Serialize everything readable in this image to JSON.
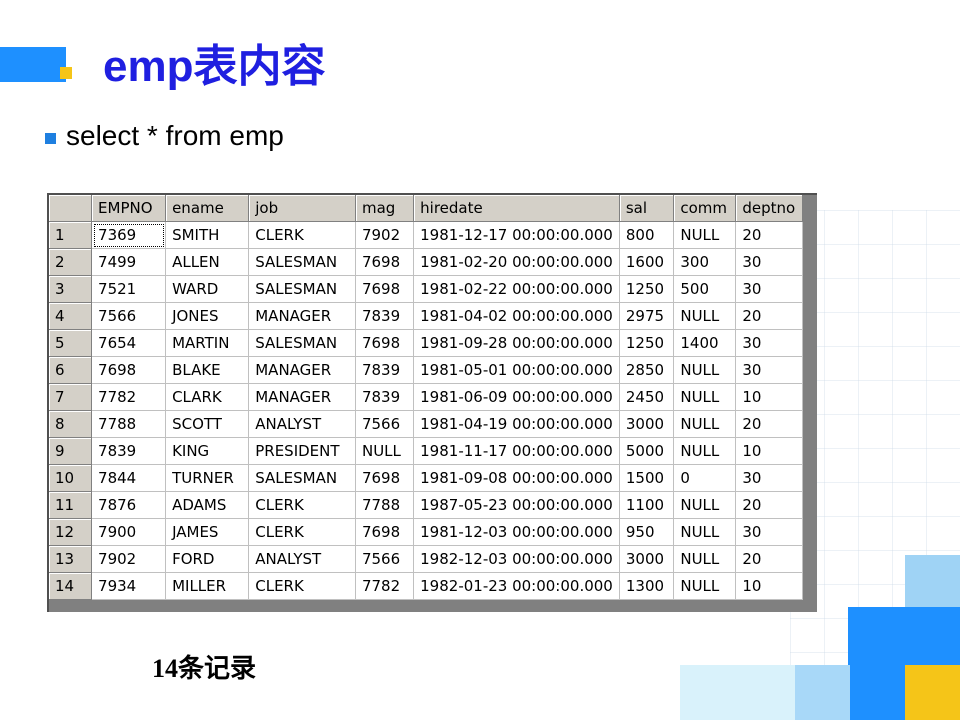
{
  "slide": {
    "title": "emp表内容",
    "bullet": "select * from emp",
    "caption": "14条记录"
  },
  "colors": {
    "title": "#1f1fe0",
    "accent_blue": "#1e90ff",
    "accent_yellow": "#f5c518",
    "grid_header": "#d4d0c8"
  },
  "table": {
    "columns": [
      "",
      "EMPNO",
      "ename",
      "job",
      "mag",
      "hiredate",
      "sal",
      "comm",
      "deptno"
    ],
    "rows": [
      [
        "1",
        "7369",
        "SMITH",
        "CLERK",
        "7902",
        "1981-12-17 00:00:00.000",
        "800",
        "NULL",
        "20"
      ],
      [
        "2",
        "7499",
        "ALLEN",
        "SALESMAN",
        "7698",
        "1981-02-20 00:00:00.000",
        "1600",
        "300",
        "30"
      ],
      [
        "3",
        "7521",
        "WARD",
        "SALESMAN",
        "7698",
        "1981-02-22 00:00:00.000",
        "1250",
        "500",
        "30"
      ],
      [
        "4",
        "7566",
        "JONES",
        "MANAGER",
        "7839",
        "1981-04-02 00:00:00.000",
        "2975",
        "NULL",
        "20"
      ],
      [
        "5",
        "7654",
        "MARTIN",
        "SALESMAN",
        "7698",
        "1981-09-28 00:00:00.000",
        "1250",
        "1400",
        "30"
      ],
      [
        "6",
        "7698",
        "BLAKE",
        "MANAGER",
        "7839",
        "1981-05-01 00:00:00.000",
        "2850",
        "NULL",
        "30"
      ],
      [
        "7",
        "7782",
        "CLARK",
        "MANAGER",
        "7839",
        "1981-06-09 00:00:00.000",
        "2450",
        "NULL",
        "10"
      ],
      [
        "8",
        "7788",
        "SCOTT",
        "ANALYST",
        "7566",
        "1981-04-19 00:00:00.000",
        "3000",
        "NULL",
        "20"
      ],
      [
        "9",
        "7839",
        "KING",
        "PRESIDENT",
        "NULL",
        "1981-11-17 00:00:00.000",
        "5000",
        "NULL",
        "10"
      ],
      [
        "10",
        "7844",
        "TURNER",
        "SALESMAN",
        "7698",
        "1981-09-08 00:00:00.000",
        "1500",
        "0",
        "30"
      ],
      [
        "11",
        "7876",
        "ADAMS",
        "CLERK",
        "7788",
        "1987-05-23 00:00:00.000",
        "1100",
        "NULL",
        "20"
      ],
      [
        "12",
        "7900",
        "JAMES",
        "CLERK",
        "7698",
        "1981-12-03 00:00:00.000",
        "950",
        "NULL",
        "30"
      ],
      [
        "13",
        "7902",
        "FORD",
        "ANALYST",
        "7566",
        "1982-12-03 00:00:00.000",
        "3000",
        "NULL",
        "20"
      ],
      [
        "14",
        "7934",
        "MILLER",
        "CLERK",
        "7782",
        "1982-01-23 00:00:00.000",
        "1300",
        "NULL",
        "10"
      ]
    ]
  }
}
